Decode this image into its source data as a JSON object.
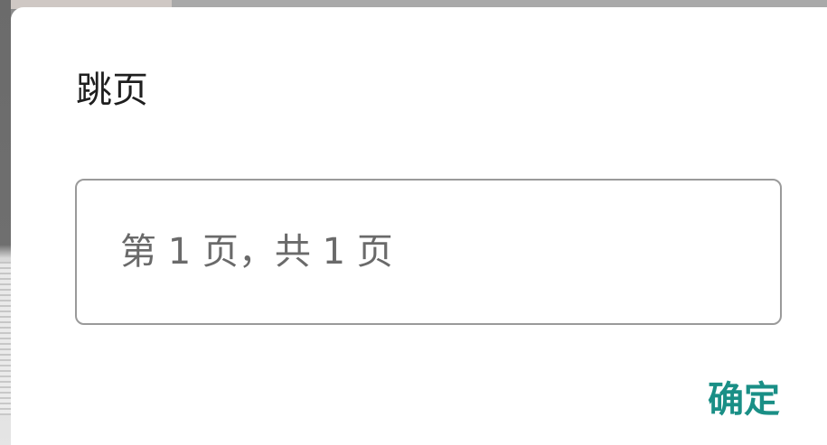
{
  "dialog": {
    "title": "跳页",
    "input": {
      "value": "",
      "placeholder": "第 1 页，共 1 页"
    },
    "confirm_label": "确定"
  },
  "colors": {
    "accent": "#1a8f86",
    "field_border": "#9a9a9a",
    "title_text": "#1f1f1f",
    "placeholder_text": "#6a6a6a"
  }
}
